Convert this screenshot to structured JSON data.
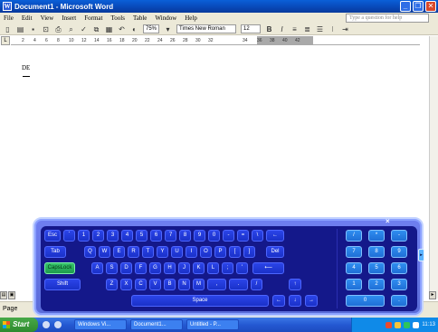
{
  "window": {
    "title": "Document1 - Microsoft Word"
  },
  "menubar": {
    "items": [
      "File",
      "Edit",
      "View",
      "Insert",
      "Format",
      "Tools",
      "Table",
      "Window",
      "Help"
    ],
    "help_placeholder": "Type a question for help"
  },
  "toolbar": {
    "zoom": "75%",
    "font": "Times New Roman",
    "size": "12",
    "bold": "B",
    "italic": "I"
  },
  "ruler": {
    "numbers": [
      "2",
      "4",
      "6",
      "8",
      "10",
      "12",
      "14",
      "16",
      "18",
      "20",
      "22",
      "24",
      "26",
      "28",
      "30",
      "32",
      "34",
      "36",
      "38",
      "40",
      "42"
    ]
  },
  "document": {
    "text": "DE"
  },
  "statusbar": {
    "page_label": "Page"
  },
  "taskbar": {
    "start_label": "Start",
    "items": [
      "Windows Vi...",
      "Document1...",
      "Untitled - P..."
    ],
    "clock": "11:13"
  },
  "keyboard": {
    "close_glyph": "×",
    "side_tab": "▸",
    "row1": [
      "Esc",
      "`",
      "1",
      "2",
      "3",
      "4",
      "5",
      "6",
      "7",
      "8",
      "9",
      "0",
      "-",
      "=",
      "\\",
      "←"
    ],
    "row2": [
      "Tab",
      "Q",
      "W",
      "E",
      "R",
      "T",
      "Y",
      "U",
      "I",
      "O",
      "P",
      "[",
      "]",
      "Del"
    ],
    "row3": [
      "CapsLock",
      "A",
      "S",
      "D",
      "F",
      "G",
      "H",
      "J",
      "K",
      "L",
      ";",
      "'",
      "⟵"
    ],
    "row4": [
      "Shift",
      "Z",
      "X",
      "C",
      "V",
      "B",
      "N",
      "M",
      ",",
      ".",
      "/",
      "↑"
    ],
    "row5": [
      "Space",
      "←",
      "↓",
      "→"
    ],
    "numpad": [
      "/",
      "*",
      "-",
      "7",
      "8",
      "9",
      "4",
      "5",
      "6",
      "1",
      "2",
      "3",
      "0",
      "."
    ]
  }
}
